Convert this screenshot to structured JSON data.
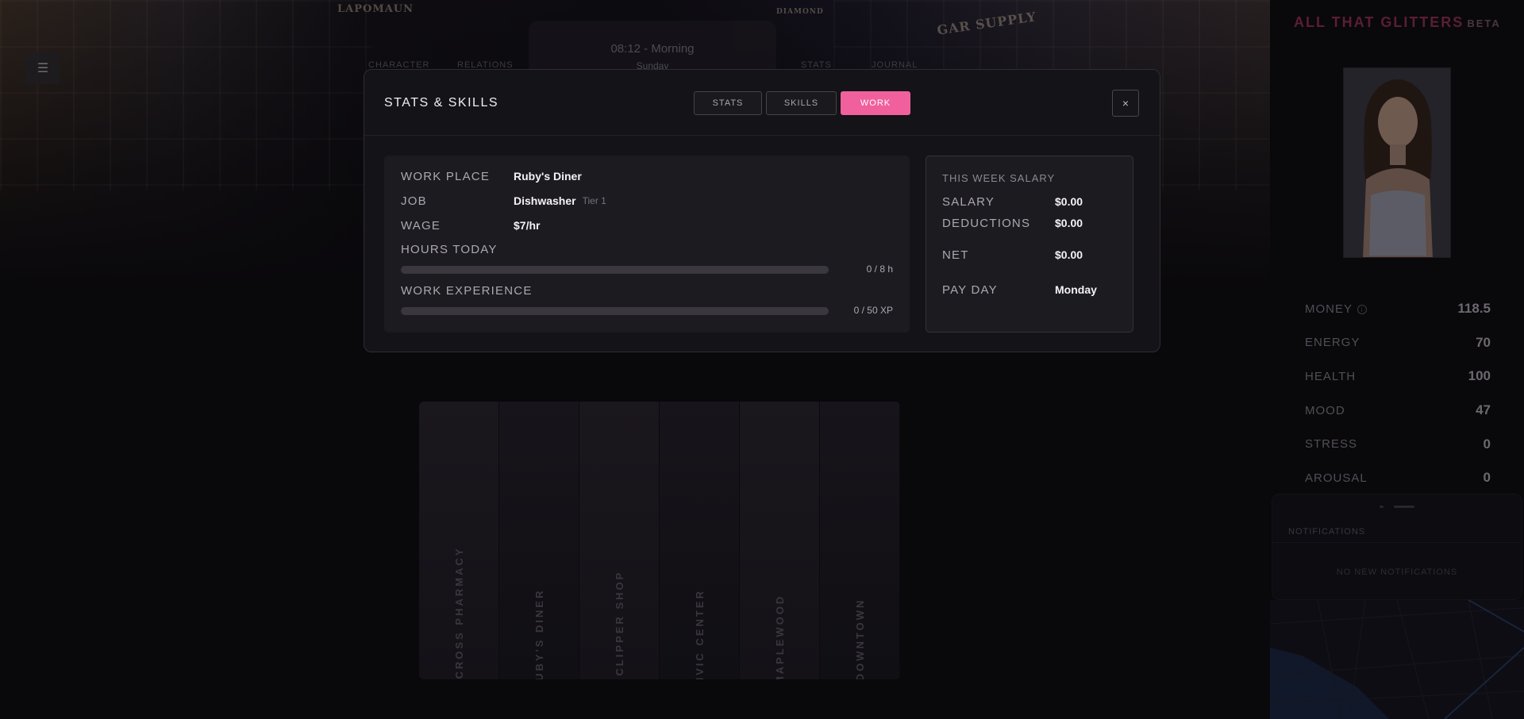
{
  "app": {
    "title": "ALL THAT GLITTERS",
    "badge": "BETA",
    "accent_color": "#f0609c"
  },
  "background": {
    "menu_icon": "hamburger-icon",
    "clock": {
      "time": "08:12 - Morning",
      "day": "Sunday"
    },
    "nav": [
      "CHARACTER",
      "RELATIONS",
      "STATS",
      "JOURNAL"
    ],
    "shop_signs": [
      "LAPOMAUN",
      "DIAMOND",
      "GAR SUPPLY"
    ],
    "locations": [
      "GREEN CROSS PHARMACY",
      "RUBY'S DINER",
      "THE CLIPPER SHOP",
      "CIVIC CENTER",
      "MAPLEWOOD",
      "DOWNTOWN"
    ]
  },
  "sidebar": {
    "stats": [
      {
        "label": "MONEY",
        "value": "118.5",
        "info": true
      },
      {
        "label": "ENERGY",
        "value": "70"
      },
      {
        "label": "HEALTH",
        "value": "100"
      },
      {
        "label": "MOOD",
        "value": "47"
      },
      {
        "label": "STRESS",
        "value": "0"
      },
      {
        "label": "AROUSAL",
        "value": "0"
      }
    ],
    "notifications": {
      "title": "NOTIFICATIONS",
      "empty": "NO NEW NOTIFICATIONS"
    }
  },
  "modal": {
    "title": "STATS & SKILLS",
    "tabs": [
      {
        "label": "STATS",
        "active": false
      },
      {
        "label": "SKILLS",
        "active": false
      },
      {
        "label": "WORK",
        "active": true
      }
    ],
    "close_label": "×",
    "work": {
      "place_label": "WORK PLACE",
      "place": "Ruby's Diner",
      "job_label": "JOB",
      "job": "Dishwasher",
      "tier": "Tier 1",
      "wage_label": "WAGE",
      "wage": "$7/hr",
      "hours_label": "HOURS TODAY",
      "hours_text": "0 / 8 h",
      "hours_progress": 0,
      "xp_label": "WORK EXPERIENCE",
      "xp_text": "0 / 50 XP",
      "xp_progress": 0
    },
    "salary": {
      "title": "THIS WEEK SALARY",
      "salary_label": "SALARY",
      "salary": "$0.00",
      "deductions_label": "DEDUCTIONS",
      "deductions": "$0.00",
      "net_label": "NET",
      "net": "$0.00",
      "payday_label": "PAY DAY",
      "payday": "Monday"
    }
  }
}
